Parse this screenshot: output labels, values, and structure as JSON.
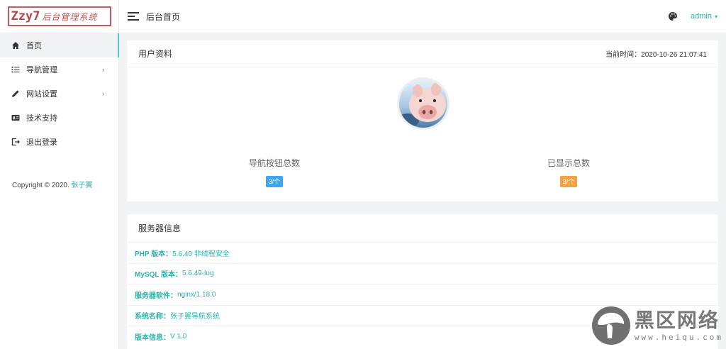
{
  "logo": {
    "main": "Zzy7",
    "sub": "后台管理系统"
  },
  "sidebar": {
    "items": [
      {
        "label": "首页",
        "icon": "home-icon",
        "active": true
      },
      {
        "label": "导航管理",
        "icon": "list-icon",
        "has_children": true
      },
      {
        "label": "网站设置",
        "icon": "pencil-icon",
        "has_children": true
      },
      {
        "label": "技术支持",
        "icon": "contact-card-icon"
      },
      {
        "label": "退出登录",
        "icon": "logout-icon"
      }
    ],
    "arrow": "›",
    "copyright_prefix": "Copyright © 2020.",
    "copyright_author": "张子翼"
  },
  "header": {
    "title": "后台首页",
    "user": "admin",
    "caret": "▾"
  },
  "profile_card": {
    "title": "用户资料",
    "time_label": "当前时间：",
    "time_value": "2020-10-26 21:07:41",
    "stats": [
      {
        "label": "导航按钮总数",
        "value": "3/个",
        "color": "#3da6f2"
      },
      {
        "label": "已显示总数",
        "value": "3/个",
        "color": "#f7a240"
      }
    ]
  },
  "server_card": {
    "title": "服务器信息",
    "rows": [
      {
        "key": "PHP 版本：",
        "value": "5.6.40 非线程安全"
      },
      {
        "key": "MySQL 版本：",
        "value": "5.6.49-log"
      },
      {
        "key": "服务器软件：",
        "value": "nginx/1.18.0"
      },
      {
        "key": "系统名称：",
        "value": "张子翼导航系统"
      },
      {
        "key": "版本信息：",
        "value": "V 1.0"
      }
    ]
  },
  "watermark": {
    "cn": "黑区网络",
    "url": "www.heiqu.com"
  },
  "colors": {
    "accent": "#2bb5aa",
    "active_bar": "#4ecdc4",
    "logo": "#b04646"
  }
}
